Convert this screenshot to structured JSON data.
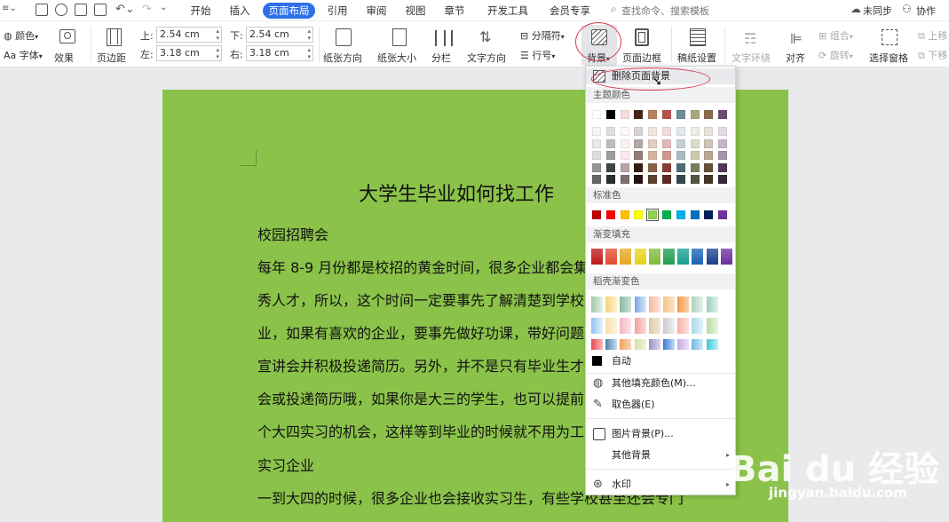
{
  "topbar": {
    "menu_tabs": [
      "开始",
      "插入",
      "页面布局",
      "引用",
      "审阅",
      "视图",
      "章节",
      "开发工具",
      "会员专享"
    ],
    "active_tab": "页面布局",
    "search_placeholder": "查找命令、搜索模板",
    "sync_label": "未同步",
    "collab_label": "协作"
  },
  "ribbon": {
    "theme_color": "颜色",
    "theme_font": "字体",
    "effects": "效果",
    "margins": "页边距",
    "margin_top_label": "上:",
    "margin_top_value": "2.54 cm",
    "margin_bottom_label": "下:",
    "margin_bottom_value": "2.54 cm",
    "margin_left_label": "左:",
    "margin_left_value": "3.18 cm",
    "margin_right_label": "右:",
    "margin_right_value": "3.18 cm",
    "orientation": "纸张方向",
    "paper_size": "纸张大小",
    "columns": "分栏",
    "text_direction": "文字方向",
    "breaks": "分隔符",
    "line_numbers": "行号",
    "background": "背景",
    "page_border": "页面边框",
    "manuscript": "稿纸设置",
    "text_wrap": "文字环绕",
    "align": "对齐",
    "group": "组合",
    "rotate": "旋转",
    "selection_pane": "选择窗格",
    "bring_forward": "上移",
    "send_backward": "下移"
  },
  "document": {
    "title": "大学生毕业如何找工作",
    "lines": [
      "校园招聘会",
      "每年 8-9 月份都是校招的黄金时间，很多企业都会集",
      "秀人才，所以，这个时间一定要事先了解清楚到学校",
      "业，如果有喜欢的企业，要事先做好功课，带好问题",
      "宣讲会并积极投递简历。另外，并不是只有毕业生才",
      "会或投递简历哦，如果你是大三的学生，也可以提前",
      "个大四实习的机会，这样等到毕业的时候就不用为工",
      "实习企业",
      "一到大四的时候，很多企业也会接收实习生，有些学校甚至还会专门"
    ],
    "background_color": "#8BC34A"
  },
  "menu": {
    "remove_bg": "删除页面背景",
    "theme_colors_header": "主题颜色",
    "standard_colors_header": "标准色",
    "gradient_fill_header": "渐变填充",
    "docer_gradient_header": "稻壳渐变色",
    "auto_label": "自动",
    "more_fill_colors": "其他填充颜色(M)...",
    "eyedropper": "取色器(E)",
    "picture_background": "图片背景(P)...",
    "other_background": "其他背景",
    "watermark": "水印",
    "theme_row1": [
      "#FFFFFF",
      "#000000",
      "#F7D9DE",
      "#4A2418",
      "#B9815E",
      "#B5524A",
      "#6B8E9A",
      "#A9A77C",
      "#8A6A4B",
      "#6D4B73"
    ],
    "standard_colors": [
      "#C00000",
      "#FF0000",
      "#FFC000",
      "#FFFF00",
      "#92D050",
      "#00B050",
      "#00B0F0",
      "#0070C0",
      "#002060",
      "#7030A0"
    ],
    "gradient_fill": [
      "#C0181A",
      "#E04A2E",
      "#E8A623",
      "#E6D21B",
      "#7DBB3A",
      "#1E9E52",
      "#169E8E",
      "#1A62B5",
      "#1B3E8E",
      "#6D2E9C"
    ]
  },
  "watermark": {
    "activate_title": "激活 Windows",
    "activate_sub": "转到\"设置\"以激活 Win",
    "baidu_logo": "Bai du 经验",
    "baidu_url": "jingyan.baidu.com"
  }
}
